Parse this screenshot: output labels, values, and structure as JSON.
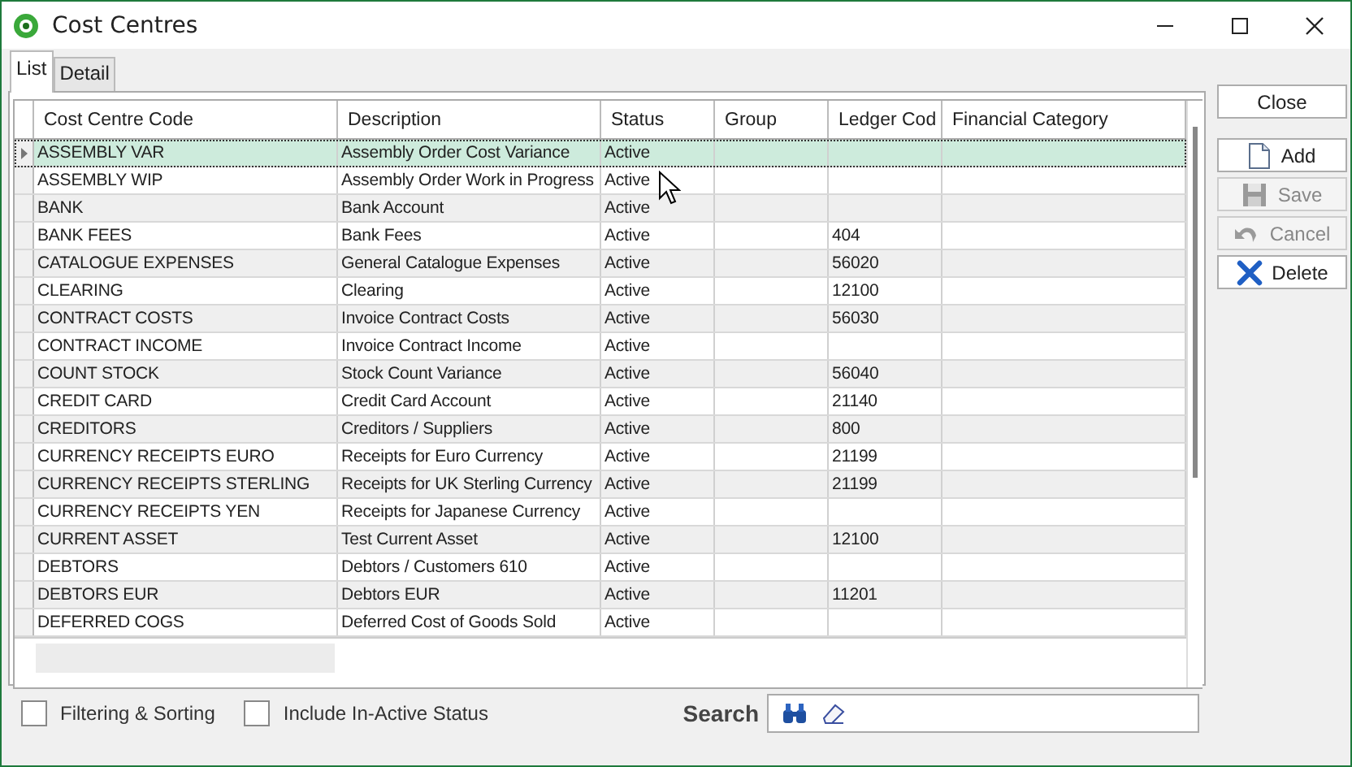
{
  "window": {
    "title": "Cost Centres"
  },
  "tabs": [
    {
      "label": "List",
      "selected": true
    },
    {
      "label": "Detail",
      "selected": false
    }
  ],
  "table": {
    "columns": [
      "Cost Centre Code",
      "Description",
      "Status",
      "Group",
      "Ledger Cod",
      "Financial Category"
    ],
    "rows": [
      {
        "cells": [
          "ASSEMBLY VAR",
          "Assembly Order Cost Variance",
          "Active",
          "",
          "",
          ""
        ],
        "selected": true
      },
      {
        "cells": [
          "ASSEMBLY WIP",
          "Assembly Order Work in Progress",
          "Active",
          "",
          "",
          ""
        ],
        "selected": false
      },
      {
        "cells": [
          "BANK",
          "Bank Account",
          "Active",
          "",
          "",
          ""
        ],
        "selected": false
      },
      {
        "cells": [
          "BANK FEES",
          "Bank Fees",
          "Active",
          "",
          "404",
          ""
        ],
        "selected": false
      },
      {
        "cells": [
          "CATALOGUE EXPENSES",
          "General Catalogue Expenses",
          "Active",
          "",
          "56020",
          ""
        ],
        "selected": false
      },
      {
        "cells": [
          "CLEARING",
          "Clearing",
          "Active",
          "",
          "12100",
          ""
        ],
        "selected": false
      },
      {
        "cells": [
          "CONTRACT COSTS",
          "Invoice Contract Costs",
          "Active",
          "",
          "56030",
          ""
        ],
        "selected": false
      },
      {
        "cells": [
          "CONTRACT INCOME",
          "Invoice Contract Income",
          "Active",
          "",
          "",
          ""
        ],
        "selected": false
      },
      {
        "cells": [
          "COUNT STOCK",
          "Stock Count Variance",
          "Active",
          "",
          "56040",
          ""
        ],
        "selected": false
      },
      {
        "cells": [
          "CREDIT CARD",
          "Credit Card Account",
          "Active",
          "",
          "21140",
          ""
        ],
        "selected": false
      },
      {
        "cells": [
          "CREDITORS",
          "Creditors / Suppliers",
          "Active",
          "",
          "800",
          ""
        ],
        "selected": false
      },
      {
        "cells": [
          "CURRENCY RECEIPTS EURO",
          "Receipts for Euro Currency",
          "Active",
          "",
          "21199",
          ""
        ],
        "selected": false
      },
      {
        "cells": [
          "CURRENCY RECEIPTS STERLING",
          "Receipts for UK Sterling Currency",
          "Active",
          "",
          "21199",
          ""
        ],
        "selected": false
      },
      {
        "cells": [
          "CURRENCY RECEIPTS YEN",
          "Receipts for Japanese Currency",
          "Active",
          "",
          "",
          ""
        ],
        "selected": false
      },
      {
        "cells": [
          "CURRENT ASSET",
          "Test Current Asset",
          "Active",
          "",
          "12100",
          ""
        ],
        "selected": false
      },
      {
        "cells": [
          "DEBTORS",
          "Debtors / Customers 610",
          "Active",
          "",
          "",
          ""
        ],
        "selected": false
      },
      {
        "cells": [
          "DEBTORS EUR",
          "Debtors EUR",
          "Active",
          "",
          "11201",
          ""
        ],
        "selected": false
      },
      {
        "cells": [
          "DEFERRED COGS",
          "Deferred Cost of Goods Sold",
          "Active",
          "",
          "",
          ""
        ],
        "selected": false
      }
    ]
  },
  "buttons": [
    {
      "label": "Close",
      "kind": "close",
      "disabled": false
    },
    {
      "label": "Add",
      "kind": "add",
      "disabled": false
    },
    {
      "label": "Save",
      "kind": "save",
      "disabled": true
    },
    {
      "label": "Cancel",
      "kind": "cancel",
      "disabled": true
    },
    {
      "label": "Delete",
      "kind": "delete",
      "disabled": false
    }
  ],
  "options": [
    {
      "label": "Filtering & Sorting",
      "checked": false
    },
    {
      "label": "Include In-Active Status",
      "checked": false
    }
  ],
  "search": {
    "label": "Search"
  }
}
